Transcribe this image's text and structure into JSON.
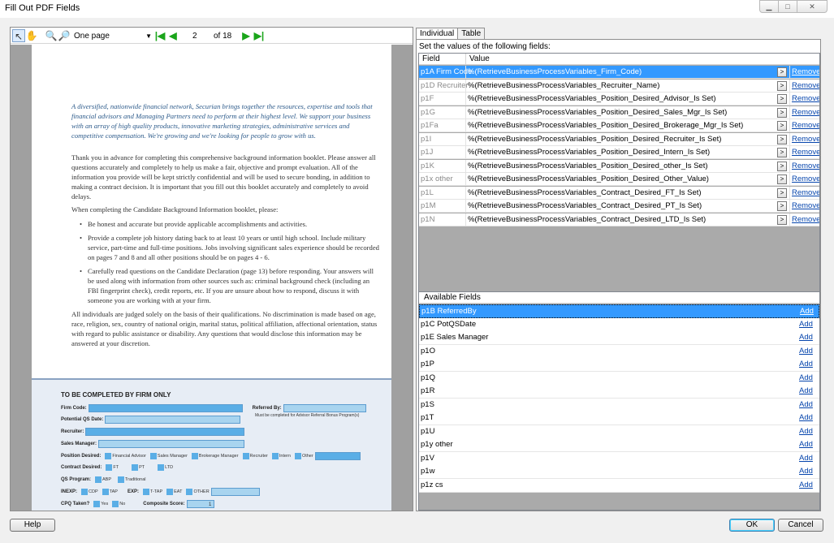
{
  "window": {
    "title": "Fill Out PDF Fields"
  },
  "viewer": {
    "zoom_mode": "One page",
    "current_page": "2",
    "page_total": "of 18",
    "document": {
      "intro": "A diversified, nationwide financial network, Securian brings together the resources, expertise and tools that financial advisors and Managing Partners need to perform at their highest level. We support your business with an array of high quality products, innovative marketing strategies, administrative services and competitive compensation. We're growing and we're looking for people to grow with us.",
      "para1": "Thank you in advance for completing this comprehensive background information booklet. Please answer all questions accurately and completely to help us make a fair, objective and prompt evaluation. All of the information you provide will be kept strictly confidential and will be used to secure bonding, in addition to making a contract decision. It is important that you fill out this booklet accurately and completely to avoid delays.",
      "para2": "When completing the Candidate Background Information booklet, please:",
      "bullets": [
        "Be honest and accurate but provide applicable accomplishments and activities.",
        "Provide a complete job history dating back to at least 10 years or until high school. Include military service, part-time and full-time positions. Jobs involving significant sales experience should be recorded on pages 7 and 8 and all other positions should be on pages 4 - 6.",
        "Carefully read questions on the Candidate Declaration (page 13) before responding. Your answers will be used along with information from other sources such as: criminal background check (including an FBI fingerprint check), credit reports, etc. If you are unsure about how to respond, discuss it with someone you are working with at your firm."
      ],
      "para3": "All individuals are judged solely on the basis of their qualifications. No discrimination is made based on age, race, religion, sex, country of national origin, marital status, political affiliation, affectional orientation, status with regard to public assistance or disability. Any questions that would disclose this information may be answered at your discretion.",
      "firm_box": {
        "title": "TO BE COMPLETED BY FIRM ONLY",
        "firm_code": "Firm Code:",
        "referred_by": "Referred By:",
        "referred_note": "Must be completed for Advisor Referral Bonus Program(s)",
        "potential_qs": "Potential QS Date:",
        "recruiter": "Recruiter:",
        "sales_manager": "Sales Manager:",
        "position_desired": "Position Desired:",
        "position_opts": [
          "Financial Advisor",
          "Sales Manager",
          "Brokerage Manager",
          "Recruiter",
          "Intern",
          "Other"
        ],
        "contract_desired": "Contract Desired:",
        "contract_opts": [
          "FT",
          "PT",
          "LTD"
        ],
        "qs_program": "QS Program:",
        "qs_opts": [
          "ABP",
          "Traditional"
        ],
        "inexp": "INEXP:",
        "inexp_opts": [
          "CDP",
          "TAP"
        ],
        "exp": "EXP:",
        "exp_opts": [
          "T-TAP",
          "EAT",
          "OTHER"
        ],
        "cpq": "CPQ Taken?",
        "cpq_opts": [
          "Yes",
          "No"
        ],
        "composite": "Composite Score:",
        "page_number": "1"
      }
    }
  },
  "tabs": [
    "Individual",
    "Table"
  ],
  "instruction": "Set the values of the following fields:",
  "fields_grid": {
    "headers": [
      "Field",
      "Value"
    ],
    "ellipsis": ">",
    "remove_label": "Remove",
    "rows": [
      {
        "field": "p1A Firm Code",
        "value": "%(RetrieveBusinessProcessVariables_Firm_Code)"
      },
      {
        "field": "p1D Recruiter",
        "value": "%(RetrieveBusinessProcessVariables_Recruiter_Name)"
      },
      {
        "field": "p1F",
        "value": "%(RetrieveBusinessProcessVariables_Position_Desired_Advisor_Is Set)"
      },
      {
        "field": "p1G",
        "value": "%(RetrieveBusinessProcessVariables_Position_Desired_Sales_Mgr_Is Set)"
      },
      {
        "field": "p1Fa",
        "value": "%(RetrieveBusinessProcessVariables_Position_Desired_Brokerage_Mgr_Is Set)"
      },
      {
        "field": "p1I",
        "value": "%(RetrieveBusinessProcessVariables_Position_Desired_Recruiter_Is Set)"
      },
      {
        "field": "p1J",
        "value": "%(RetrieveBusinessProcessVariables_Position_Desired_Intern_Is Set)"
      },
      {
        "field": "p1K",
        "value": "%(RetrieveBusinessProcessVariables_Position_Desired_other_Is Set)"
      },
      {
        "field": "p1x other",
        "value": "%(RetrieveBusinessProcessVariables_Position_Desired_Other_Value)"
      },
      {
        "field": "p1L",
        "value": "%(RetrieveBusinessProcessVariables_Contract_Desired_FT_Is Set)"
      },
      {
        "field": "p1M",
        "value": "%(RetrieveBusinessProcessVariables_Contract_Desired_PT_Is Set)"
      },
      {
        "field": "p1N",
        "value": "%(RetrieveBusinessProcessVariables_Contract_Desired_LTD_Is Set)"
      }
    ]
  },
  "available_fields": {
    "header": "Available Fields",
    "add_label": "Add",
    "items": [
      "p1B ReferredBy",
      "p1C PotQSDate",
      "p1E Sales Manager",
      "p1O",
      "p1P",
      "p1Q",
      "p1R",
      "p1S",
      "p1T",
      "p1U",
      "p1y other",
      "p1V",
      "p1w",
      "p1z cs"
    ]
  },
  "buttons": {
    "help": "Help",
    "ok": "OK",
    "cancel": "Cancel"
  }
}
